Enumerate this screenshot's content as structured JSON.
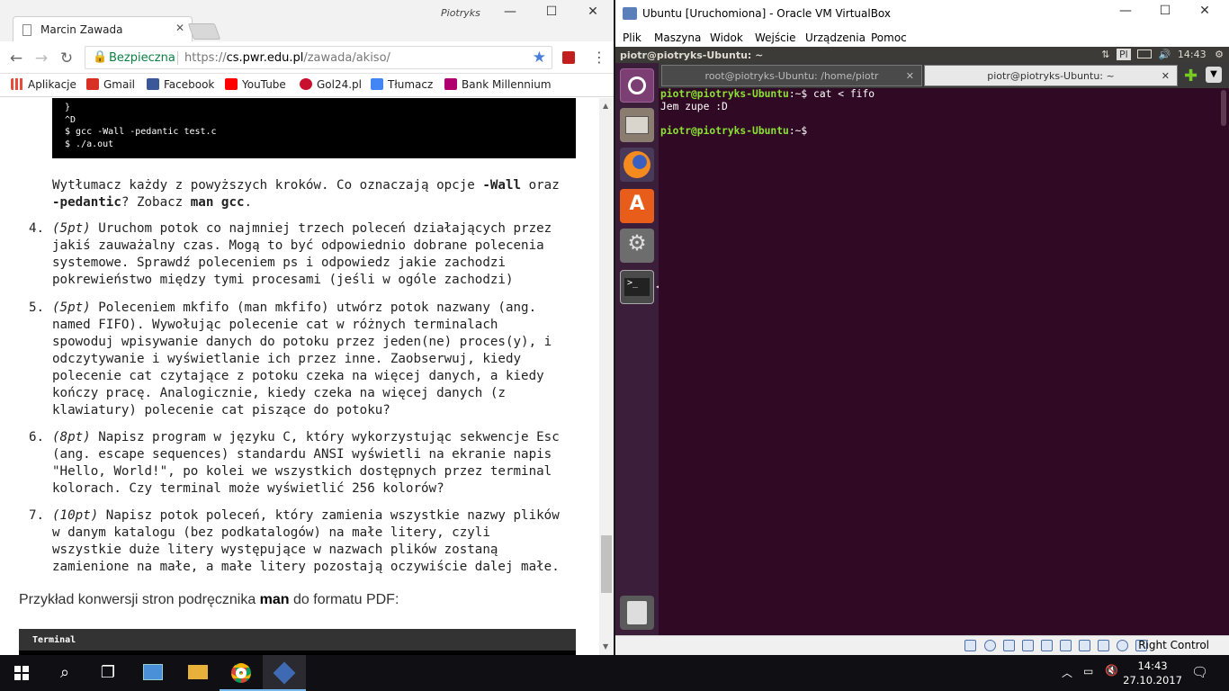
{
  "chrome": {
    "tab_title": "Marcin Zawada",
    "tab_close": "✕",
    "user_name": "Piotryks",
    "win_min": "—",
    "win_max": "☐",
    "win_close": "✕",
    "back": "←",
    "forward": "→",
    "reload": "↻",
    "secure_label": "Bezpieczna",
    "url_scheme": "https://",
    "url_host": "cs.pwr.edu.pl",
    "url_path": "/zawada/akiso/",
    "star": "★",
    "menu": "⋮",
    "bookmarks": [
      {
        "label": "Aplikacje",
        "color": "#e84c3d"
      },
      {
        "label": "Gmail",
        "color": "#d93025"
      },
      {
        "label": "Facebook",
        "color": "#3b5998"
      },
      {
        "label": "YouTube",
        "color": "#ff0000"
      },
      {
        "label": "Gol24.pl",
        "color": "#c8102e"
      },
      {
        "label": "Tłumacz",
        "color": "#4285f4"
      },
      {
        "label": "Bank Millennium",
        "color": "#b0006e"
      }
    ]
  },
  "page": {
    "code_block_lines": [
      "}",
      "^D",
      "$ gcc -Wall -pedantic test.c",
      "$ ./a.out"
    ],
    "explain": {
      "t1": "Wytłumacz każdy z powyższych kroków. Co oznaczają opcje ",
      "b1": "-Wall",
      "t2": " oraz",
      "b2": "-pedantic",
      "t3": "? Zobacz ",
      "b3": "man gcc",
      "t4": "."
    },
    "items": [
      {
        "number": "4.",
        "points": "(5pt)",
        "lines": [
          " Uruchom potok co najmniej trzech poleceń działających przez",
          "jakiś zauważalny czas. Mogą to być odpowiednio dobrane polecenia",
          "systemowe. Sprawdź poleceniem ps i odpowiedz jakie zachodzi",
          "pokrewieństwo między tymi procesami (jeśli w ogóle zachodzi)"
        ]
      },
      {
        "number": "5.",
        "points": "(5pt)",
        "lines": [
          " Poleceniem mkfifo (man mkfifo) utwórz potok nazwany (ang.",
          "named FIFO). Wywołując polecenie cat w różnych terminalach",
          "spowoduj wpisywanie danych do potoku przez jeden(ne) proces(y), i",
          "odczytywanie i wyświetlanie ich przez inne. Zaobserwuj, kiedy",
          "polecenie cat czytające z potoku czeka na więcej danych, a kiedy",
          "kończy pracę. Analogicznie, kiedy czeka na więcej danych (z",
          "klawiatury) polecenie cat piszące do potoku?"
        ]
      },
      {
        "number": "6.",
        "points": "(8pt)",
        "lines": [
          " Napisz program w języku C, który wykorzystując sekwencje Esc",
          "(ang. escape sequences) standardu ANSI wyświetli na ekranie napis",
          "\"Hello, World!\", po kolei we wszystkich dostępnych przez terminal",
          "kolorach. Czy terminal może wyświetlić 256 kolorów?"
        ]
      },
      {
        "number": "7.",
        "points": "(10pt)",
        "lines": [
          " Napisz potok poleceń, który zamienia wszystkie nazwy plików",
          "w danym katalogu (bez podkatalogów) na małe litery, czyli",
          "wszystkie duże litery występujące w nazwach plików zostaną",
          "zamienione na małe, a małe litery pozostają oczywiście dalej małe."
        ]
      }
    ],
    "example_pre": "Przykład konwersji stron podręcznika ",
    "example_bold": "man",
    "example_post": " do formatu PDF:",
    "terminal_label": "Terminal"
  },
  "vbox": {
    "title": "Ubuntu [Uruchomiona] - Oracle VM VirtualBox",
    "menu": [
      "Plik",
      "Maszyna",
      "Widok",
      "Wejście",
      "Urządzenia",
      "Pomoc"
    ],
    "ubuntu_top_user": "piotr@piotryks-Ubuntu: ~",
    "ubuntu_layout": "Pl",
    "ubuntu_time": "14:43",
    "term_tabs": [
      "root@piotryks-Ubuntu: /home/piotr",
      "piotr@piotryks-Ubuntu: ~"
    ],
    "term_prompt": "piotr@piotryks-Ubuntu",
    "term_path": ":~$",
    "term_cmd": " cat < fifo",
    "term_output": "Jem zupe :D",
    "right_control": "Right Control"
  },
  "taskbar": {
    "time": "14:43",
    "date": "27.10.2017"
  }
}
